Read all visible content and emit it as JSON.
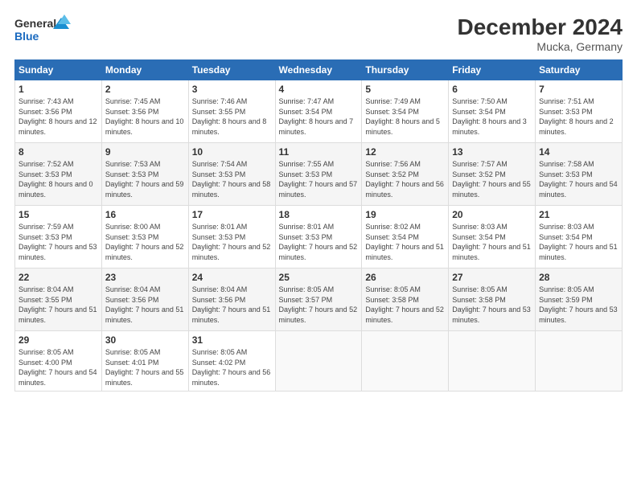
{
  "header": {
    "logo_line1": "General",
    "logo_line2": "Blue",
    "month_year": "December 2024",
    "location": "Mucka, Germany"
  },
  "weekdays": [
    "Sunday",
    "Monday",
    "Tuesday",
    "Wednesday",
    "Thursday",
    "Friday",
    "Saturday"
  ],
  "weeks": [
    [
      {
        "day": "1",
        "sunrise": "7:43 AM",
        "sunset": "3:56 PM",
        "daylight": "8 hours and 12 minutes."
      },
      {
        "day": "2",
        "sunrise": "7:45 AM",
        "sunset": "3:56 PM",
        "daylight": "8 hours and 10 minutes."
      },
      {
        "day": "3",
        "sunrise": "7:46 AM",
        "sunset": "3:55 PM",
        "daylight": "8 hours and 8 minutes."
      },
      {
        "day": "4",
        "sunrise": "7:47 AM",
        "sunset": "3:54 PM",
        "daylight": "8 hours and 7 minutes."
      },
      {
        "day": "5",
        "sunrise": "7:49 AM",
        "sunset": "3:54 PM",
        "daylight": "8 hours and 5 minutes."
      },
      {
        "day": "6",
        "sunrise": "7:50 AM",
        "sunset": "3:54 PM",
        "daylight": "8 hours and 3 minutes."
      },
      {
        "day": "7",
        "sunrise": "7:51 AM",
        "sunset": "3:53 PM",
        "daylight": "8 hours and 2 minutes."
      }
    ],
    [
      {
        "day": "8",
        "sunrise": "7:52 AM",
        "sunset": "3:53 PM",
        "daylight": "8 hours and 0 minutes."
      },
      {
        "day": "9",
        "sunrise": "7:53 AM",
        "sunset": "3:53 PM",
        "daylight": "7 hours and 59 minutes."
      },
      {
        "day": "10",
        "sunrise": "7:54 AM",
        "sunset": "3:53 PM",
        "daylight": "7 hours and 58 minutes."
      },
      {
        "day": "11",
        "sunrise": "7:55 AM",
        "sunset": "3:53 PM",
        "daylight": "7 hours and 57 minutes."
      },
      {
        "day": "12",
        "sunrise": "7:56 AM",
        "sunset": "3:52 PM",
        "daylight": "7 hours and 56 minutes."
      },
      {
        "day": "13",
        "sunrise": "7:57 AM",
        "sunset": "3:52 PM",
        "daylight": "7 hours and 55 minutes."
      },
      {
        "day": "14",
        "sunrise": "7:58 AM",
        "sunset": "3:53 PM",
        "daylight": "7 hours and 54 minutes."
      }
    ],
    [
      {
        "day": "15",
        "sunrise": "7:59 AM",
        "sunset": "3:53 PM",
        "daylight": "7 hours and 53 minutes."
      },
      {
        "day": "16",
        "sunrise": "8:00 AM",
        "sunset": "3:53 PM",
        "daylight": "7 hours and 52 minutes."
      },
      {
        "day": "17",
        "sunrise": "8:01 AM",
        "sunset": "3:53 PM",
        "daylight": "7 hours and 52 minutes."
      },
      {
        "day": "18",
        "sunrise": "8:01 AM",
        "sunset": "3:53 PM",
        "daylight": "7 hours and 52 minutes."
      },
      {
        "day": "19",
        "sunrise": "8:02 AM",
        "sunset": "3:54 PM",
        "daylight": "7 hours and 51 minutes."
      },
      {
        "day": "20",
        "sunrise": "8:03 AM",
        "sunset": "3:54 PM",
        "daylight": "7 hours and 51 minutes."
      },
      {
        "day": "21",
        "sunrise": "8:03 AM",
        "sunset": "3:54 PM",
        "daylight": "7 hours and 51 minutes."
      }
    ],
    [
      {
        "day": "22",
        "sunrise": "8:04 AM",
        "sunset": "3:55 PM",
        "daylight": "7 hours and 51 minutes."
      },
      {
        "day": "23",
        "sunrise": "8:04 AM",
        "sunset": "3:56 PM",
        "daylight": "7 hours and 51 minutes."
      },
      {
        "day": "24",
        "sunrise": "8:04 AM",
        "sunset": "3:56 PM",
        "daylight": "7 hours and 51 minutes."
      },
      {
        "day": "25",
        "sunrise": "8:05 AM",
        "sunset": "3:57 PM",
        "daylight": "7 hours and 52 minutes."
      },
      {
        "day": "26",
        "sunrise": "8:05 AM",
        "sunset": "3:58 PM",
        "daylight": "7 hours and 52 minutes."
      },
      {
        "day": "27",
        "sunrise": "8:05 AM",
        "sunset": "3:58 PM",
        "daylight": "7 hours and 53 minutes."
      },
      {
        "day": "28",
        "sunrise": "8:05 AM",
        "sunset": "3:59 PM",
        "daylight": "7 hours and 53 minutes."
      }
    ],
    [
      {
        "day": "29",
        "sunrise": "8:05 AM",
        "sunset": "4:00 PM",
        "daylight": "7 hours and 54 minutes."
      },
      {
        "day": "30",
        "sunrise": "8:05 AM",
        "sunset": "4:01 PM",
        "daylight": "7 hours and 55 minutes."
      },
      {
        "day": "31",
        "sunrise": "8:05 AM",
        "sunset": "4:02 PM",
        "daylight": "7 hours and 56 minutes."
      },
      null,
      null,
      null,
      null
    ]
  ]
}
